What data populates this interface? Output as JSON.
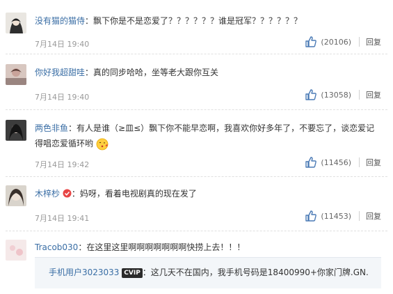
{
  "comments": [
    {
      "user": "没有猫的猫侍",
      "text": "：飘下你是不是恋爱了？？？？？？谁是冠军？？？？？？",
      "time": "7月14日 19:40",
      "likes": "(20106)",
      "reply": "回复"
    },
    {
      "user": "你好我超甜哇",
      "text": "：真的同步哈哈，坐等老大跟你互关",
      "time": "7月14日 19:40",
      "likes": "(13058)",
      "reply": "回复"
    },
    {
      "user": "两色非鱼",
      "text_line1": "：有人是谁（≥皿≤）飘下你不能早恋啊，我喜欢你好多年了，不要忘了，谈恋爱记",
      "text_line2": "得唱恋爱循环哟",
      "time": "7月14日 19:42",
      "likes": "(11456)",
      "reply": "回复"
    },
    {
      "user": "木梓杪",
      "text": "：妈呀，看着电视剧真的现在发了",
      "time": "7月14日 19:41",
      "likes": "(11453)",
      "reply": "回复"
    },
    {
      "user": "Tracob030",
      "text": "：在这里这里啊啊啊啊啊啊啊快捞上去！！！"
    }
  ],
  "sub_reply": {
    "user": "手机用户3023033",
    "vip_badge": "CVIP",
    "text": "：这几天不在国内，我手机号码是18400990+你家门牌.GN."
  },
  "icons": {
    "like": "thumbs-up-icon",
    "emoji": "kiss-emoji-icon",
    "verified": "verified-badge-icon"
  },
  "colors": {
    "username": "#3a6ea5",
    "like_icon": "#4a7ab5",
    "meta": "#999999"
  }
}
